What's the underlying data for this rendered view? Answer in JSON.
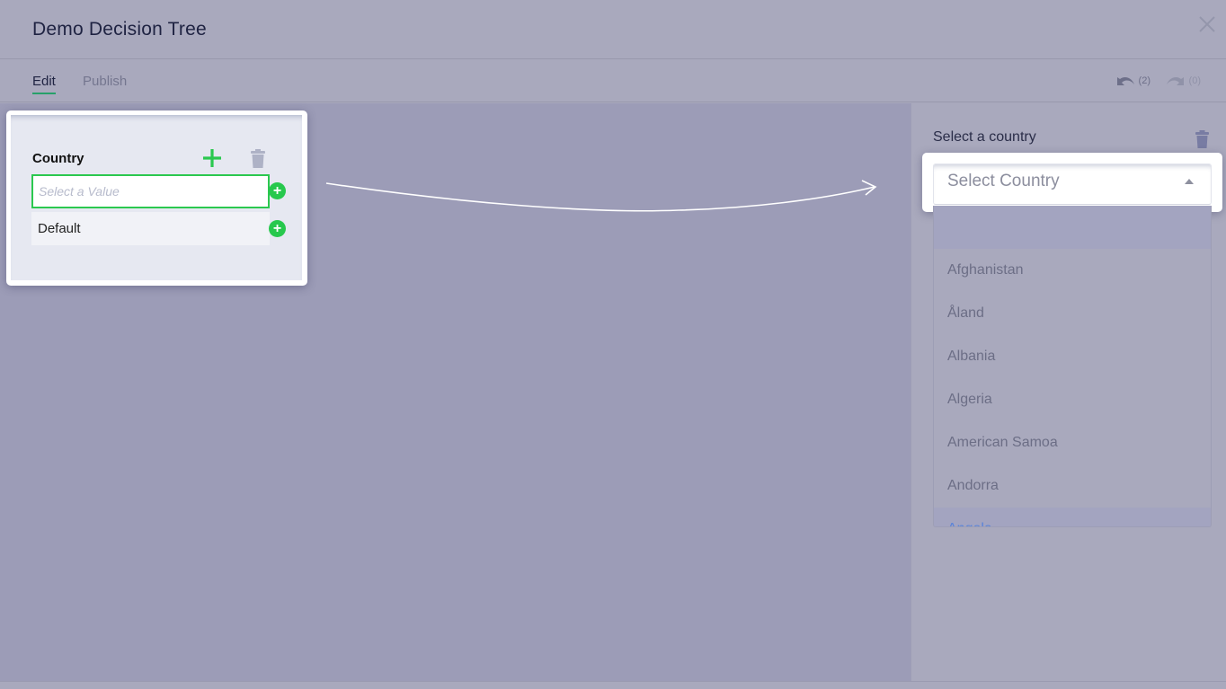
{
  "header": {
    "title": "Demo Decision Tree",
    "close_icon": "close-icon"
  },
  "tabs": [
    {
      "label": "Edit",
      "active": true
    },
    {
      "label": "Publish",
      "active": false
    }
  ],
  "history": {
    "undo_count": "(2)",
    "redo_count": "(0)"
  },
  "node": {
    "label": "Country",
    "value_placeholder": "Select a Value",
    "default_label": "Default",
    "accent_color": "#2bc84f"
  },
  "panel": {
    "label": "Select a country",
    "select_placeholder": "Select Country",
    "options": [
      {
        "label": "Afghanistan"
      },
      {
        "label": "Åland"
      },
      {
        "label": "Albania"
      },
      {
        "label": "Algeria"
      },
      {
        "label": "American Samoa"
      },
      {
        "label": "Andorra"
      },
      {
        "label": "Angola",
        "highlighted": true
      }
    ]
  }
}
